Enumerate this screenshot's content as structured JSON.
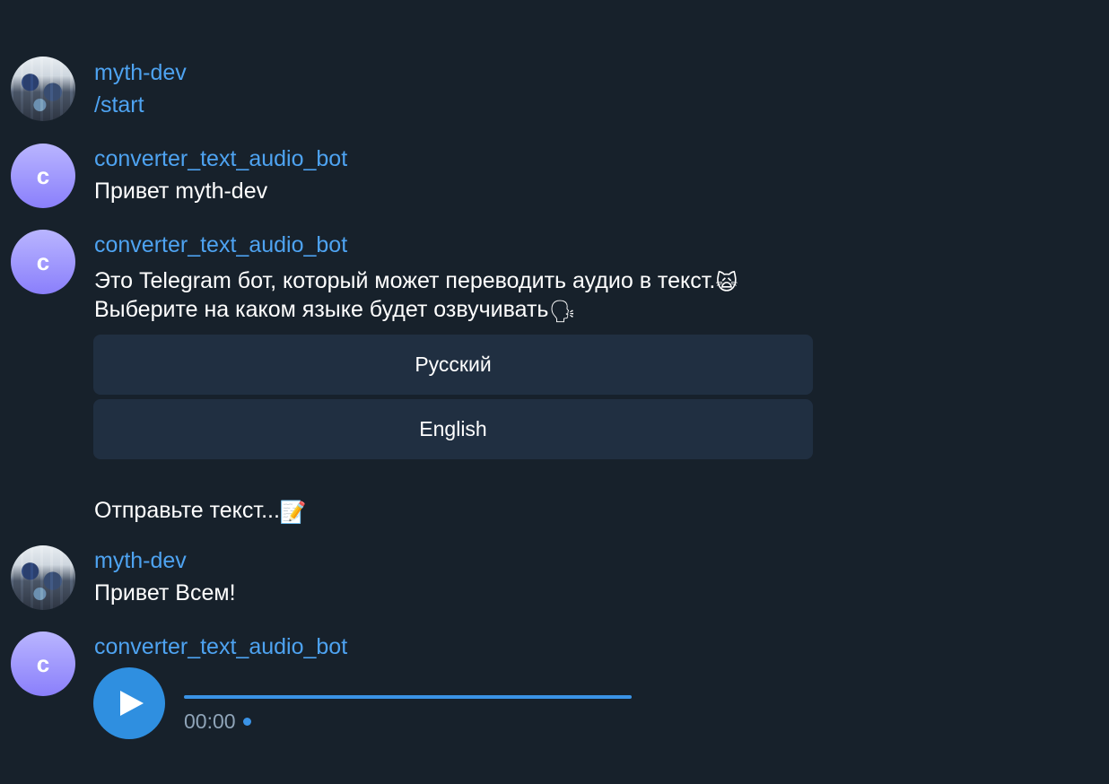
{
  "messages": {
    "m1": {
      "sender": "myth-dev",
      "avatar": "user-photo",
      "text": "/start"
    },
    "m2": {
      "sender": "converter_text_audio_bot",
      "avatar_letter": "c",
      "text": "Привет myth-dev"
    },
    "m3": {
      "sender": "converter_text_audio_bot",
      "avatar_letter": "c",
      "line1": "Это Telegram бот, который может переводить аудио в текст.",
      "line1_emoji": "🙀",
      "line2": "Выберите на каком языке будет озвучивать",
      "line2_emoji": "🗣",
      "keyboard": [
        "Русский",
        "English"
      ]
    },
    "m4": {
      "text": "Отправьте текст...",
      "emoji": "📝"
    },
    "m5": {
      "sender": "myth-dev",
      "avatar": "user-photo",
      "text": "Привет Всем!"
    },
    "m6": {
      "sender": "converter_text_audio_bot",
      "avatar_letter": "c",
      "voice": {
        "duration": "00:00",
        "play_icon": "play-icon",
        "progress": 1.0
      }
    }
  },
  "colors": {
    "background": "#17212b",
    "sender_name": "#4ea3f1",
    "text": "#ffffff",
    "button_bg": "#202f41",
    "accent": "#2f8fe0"
  }
}
